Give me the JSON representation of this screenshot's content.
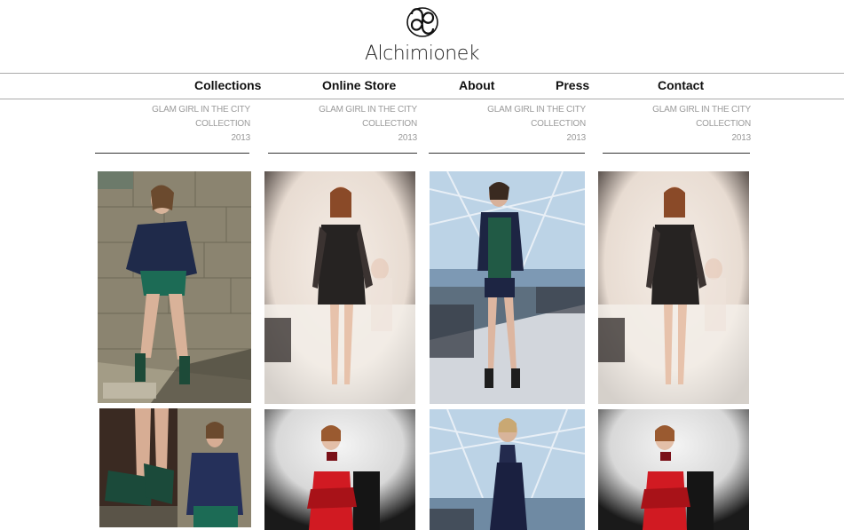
{
  "brand": {
    "name": "Alchimionek"
  },
  "nav": {
    "collections": "Collections",
    "online_store": "Online Store",
    "about": "About",
    "press": "Press",
    "contact": "Contact"
  },
  "captions": [
    {
      "line1": "GLAM GIRL IN THE CITY",
      "line2": "COLLECTION",
      "line3": "2013"
    },
    {
      "line1": "GLAM GIRL IN THE CITY",
      "line2": "COLLECTION",
      "line3": "2013"
    },
    {
      "line1": "GLAM GIRL IN THE CITY",
      "line2": "COLLECTION",
      "line3": "2013"
    },
    {
      "line1": "GLAM GIRL IN THE CITY",
      "line2": "COLLECTION",
      "line3": "2013"
    }
  ],
  "colors": {
    "nav_text": "#111111",
    "caption_text": "#9a9a9a",
    "rule": "#333333"
  },
  "icons": {
    "logo": "infinity-knot-logo-icon"
  }
}
